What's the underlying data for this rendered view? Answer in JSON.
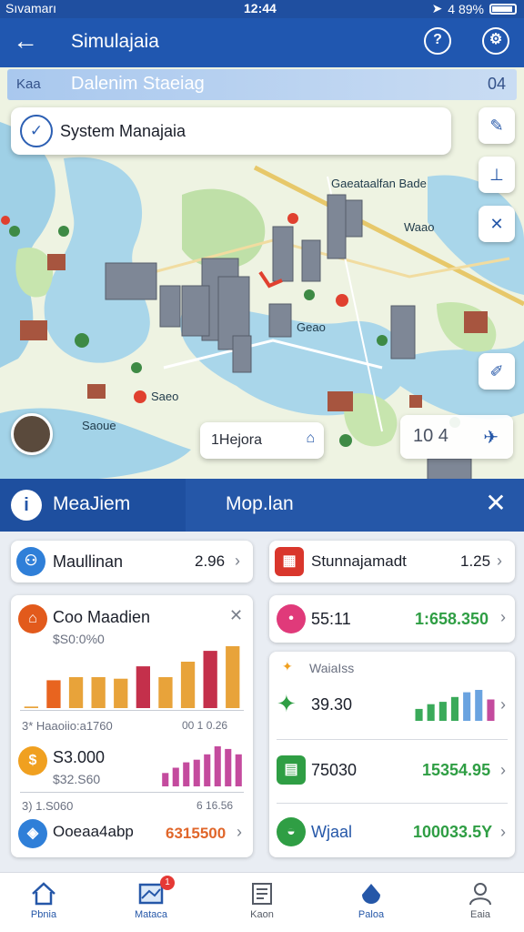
{
  "status": {
    "carrier": "Sıvamarı",
    "time": "12:44",
    "battery": "4 89%"
  },
  "appbar": {
    "title": "Simulajaia",
    "help_icon": "?"
  },
  "map": {
    "subheader": {
      "left_code": "Kaa",
      "label": "Dalenim Staeiag",
      "right_code": "04"
    },
    "search": {
      "text": "System Manajaia"
    },
    "labels": [
      "Gaeataalfan Bade",
      "Waao",
      "Geao",
      "Saeo",
      "Saoue"
    ],
    "callout": "1Hejora",
    "stat": "10 4"
  },
  "tabs": {
    "active": "MeaJiem",
    "second": "Mop.lan"
  },
  "cards": {
    "top_left": {
      "label": "Maullinan",
      "value": "2.96"
    },
    "top_right": {
      "label": "Stunnajamadt",
      "value": "1.25"
    },
    "chart_card": {
      "title": "Coo Maadien",
      "subtitle": "$S0:0%0",
      "footer_left": "3* Haaoiio:a1760",
      "footer_right": "00  1  0.26",
      "row2_value": "S3.000",
      "row2_sub": "$32.S60",
      "footer2_left": "3)  1.S060",
      "footer2_right": "6  16.56",
      "row3_label": "Ooeaa4abp",
      "row3_value": "6315500"
    },
    "right_item1": {
      "label": "55:11",
      "value": "1:658.350"
    },
    "metrics": {
      "title": "WaiaIss",
      "rows": [
        {
          "label": "39.30",
          "value": ""
        },
        {
          "label": "75030",
          "value": "15354.95"
        },
        {
          "label": "Wjaal",
          "value": "100033.5Y"
        }
      ]
    }
  },
  "chart_data": [
    {
      "type": "bar",
      "values": [
        1,
        18,
        20,
        20,
        19,
        27,
        20,
        30,
        37,
        40
      ],
      "colors": [
        "#e8a33a",
        "#e8641f",
        "#e8a33a",
        "#e8a33a",
        "#e8a33a",
        "#c4304b",
        "#e8a33a",
        "#e8a33a",
        "#c4304b",
        "#e8a33a"
      ]
    },
    {
      "type": "bar",
      "values": [
        10,
        14,
        18,
        20,
        24,
        30,
        28,
        24
      ],
      "colors": [
        "#c44b9e",
        "#c44b9e",
        "#c44b9e",
        "#c44b9e",
        "#c44b9e",
        "#c44b9e",
        "#c44b9e",
        "#c44b9e"
      ]
    },
    {
      "type": "bar",
      "values": [
        10,
        14,
        16,
        20,
        24,
        26,
        18
      ],
      "colors": [
        "#3aaa5a",
        "#3aaa5a",
        "#3aaa5a",
        "#3aaa5a",
        "#6aa3e0",
        "#6aa3e0",
        "#c44b9e"
      ]
    }
  ],
  "bottom_nav": [
    "Pbnia",
    "Mataca",
    "Kaon",
    "Paloa",
    "Eaia"
  ],
  "notif_count": "1"
}
